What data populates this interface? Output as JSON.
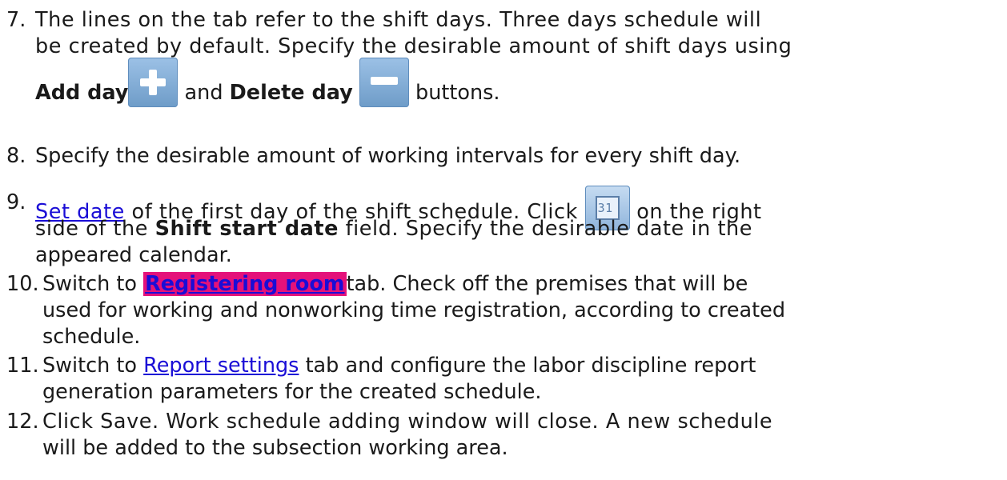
{
  "steps": [
    {
      "num": "7.",
      "line1": "The lines on the tab refer to the shift days. Three days schedule will",
      "line2": "be created by default. Specify the desirable amount of shift days using",
      "add_label": "Add day",
      "and_word": "and",
      "delete_label": "Delete day",
      "after_buttons": "buttons.",
      "add_icon": "plus-icon",
      "delete_icon": "minus-icon"
    },
    {
      "num": "8.",
      "line1": "Specify the desirable amount of working intervals for every shift day."
    },
    {
      "num": "9.",
      "link": "Set date",
      "line1_after_link": "of the first day of the shift schedule. Click",
      "line1_after_icon": "on the right",
      "line2_before_bold": "side of the",
      "bold": "Shift start date",
      "line2_after_bold": "field. Specify the desirable date in the",
      "line3": "appeared calendar.",
      "calendar_icon": "calendar-icon",
      "calendar_icon_text": "31"
    },
    {
      "num": "10.",
      "before_tab": "Switch to",
      "tab_link": "Registering room",
      "line1_after": "tab. Check off the premises that will be",
      "line2": "used for working and nonworking time registration, according to created",
      "line3": "schedule."
    },
    {
      "num": "11.",
      "before_link": "Switch to",
      "link": "Report settings",
      "line1_after": "tab and configure the labor discipline report",
      "line2": "generation parameters for the created schedule."
    },
    {
      "num": "12.",
      "line1": "Click Save. Work schedule adding window will close. A new schedule",
      "line2": "will be added to the subsection working area."
    }
  ],
  "colors": {
    "link": "#1a0dd6",
    "highlight": "#e4127a",
    "icon": "#7aa6d2"
  }
}
